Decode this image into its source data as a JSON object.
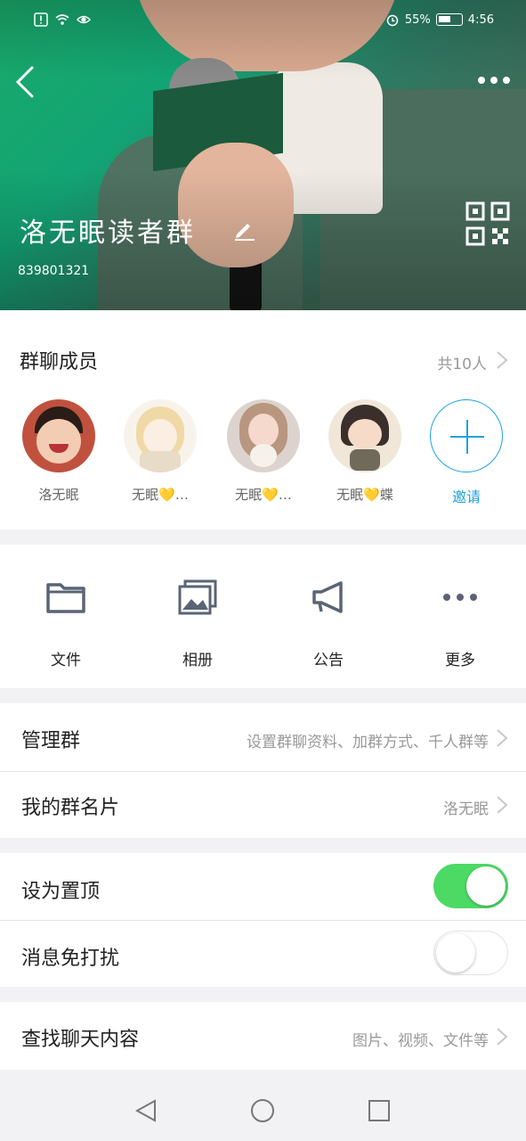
{
  "status_bar": {
    "battery": "55%",
    "time": "4:56"
  },
  "header": {
    "group_name": "洛无眠读者群",
    "group_id": "839801321"
  },
  "members": {
    "title": "群聊成员",
    "count_label": "共10人",
    "list": [
      {
        "name": "洛无眠"
      },
      {
        "name": "无眠💛…"
      },
      {
        "name": "无眠💛…"
      },
      {
        "name": "无眠💛蝶"
      }
    ],
    "invite_label": "邀请"
  },
  "functions": [
    {
      "label": "文件",
      "icon": "folder-icon"
    },
    {
      "label": "相册",
      "icon": "album-icon"
    },
    {
      "label": "公告",
      "icon": "megaphone-icon"
    },
    {
      "label": "更多",
      "icon": "more-dots-icon"
    }
  ],
  "settings": {
    "manage": {
      "label": "管理群",
      "value": "设置群聊资料、加群方式、千人群等"
    },
    "card": {
      "label": "我的群名片",
      "value": "洛无眠"
    },
    "pin": {
      "label": "设为置顶",
      "enabled": true
    },
    "mute": {
      "label": "消息免打扰",
      "enabled": false
    },
    "search": {
      "label": "查找聊天内容",
      "value": "图片、视频、文件等"
    }
  },
  "colors": {
    "accent": "#1fa2df",
    "toggle_on": "#4cd964"
  }
}
